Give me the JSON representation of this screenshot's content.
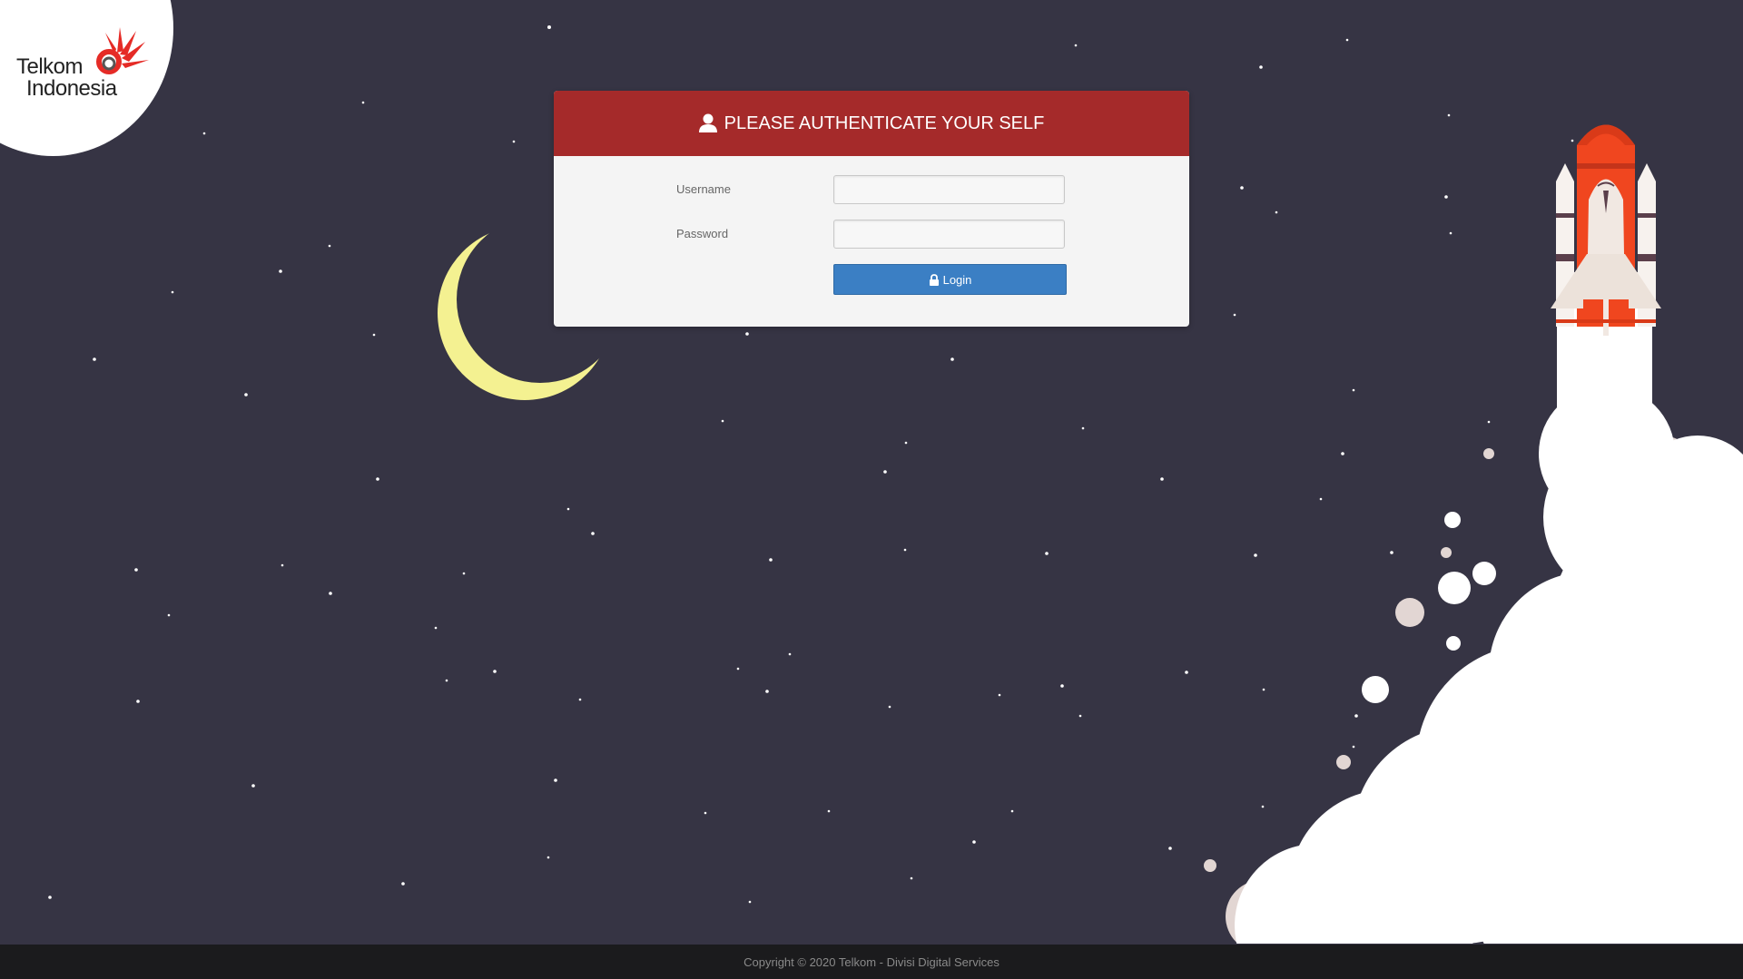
{
  "brand": {
    "line1": "Telkom",
    "line2": "Indonesia",
    "accent_color": "#e52b26"
  },
  "login_panel": {
    "title": "PLEASE AUTHENTICATE YOUR SELF",
    "header_color": "#a52a2a",
    "username_label": "Username",
    "username_value": "",
    "password_label": "Password",
    "password_value": "",
    "login_label": "Login",
    "button_color": "#3b7fc4",
    "icons": {
      "title": "user-icon",
      "button": "lock-icon"
    }
  },
  "footer": {
    "copyright": "Copyright © 2020 Telkom - Divisi Digital Services"
  },
  "background": {
    "color": "#363444",
    "decorations": [
      "stars",
      "crescent-moon",
      "rocket",
      "smoke-cloud"
    ]
  }
}
